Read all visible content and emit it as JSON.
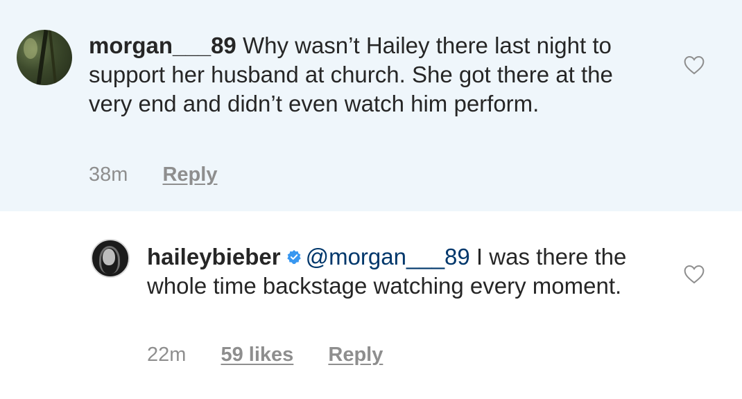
{
  "comments": [
    {
      "username": "morgan___89",
      "text": "Why wasn’t Hailey there last night to support her husband at church. She got there at the very end and didn’t even watch him perform.",
      "time": "38m",
      "reply_label": "Reply",
      "avatar_icon": "forest-avatar"
    },
    {
      "username": "haileybieber",
      "verified": true,
      "mention": "@morgan___89",
      "text": "I was there the whole time backstage watching every moment.",
      "time": "22m",
      "likes": "59 likes",
      "reply_label": "Reply",
      "avatar_icon": "portrait-avatar"
    }
  ],
  "icons": {
    "like": "heart-outline-icon",
    "verified": "verified-badge-icon"
  },
  "colors": {
    "highlight_bg": "#eff6fb",
    "text": "#262626",
    "meta": "#8e8e8e",
    "mention": "#00376b",
    "verified": "#3897f0"
  }
}
